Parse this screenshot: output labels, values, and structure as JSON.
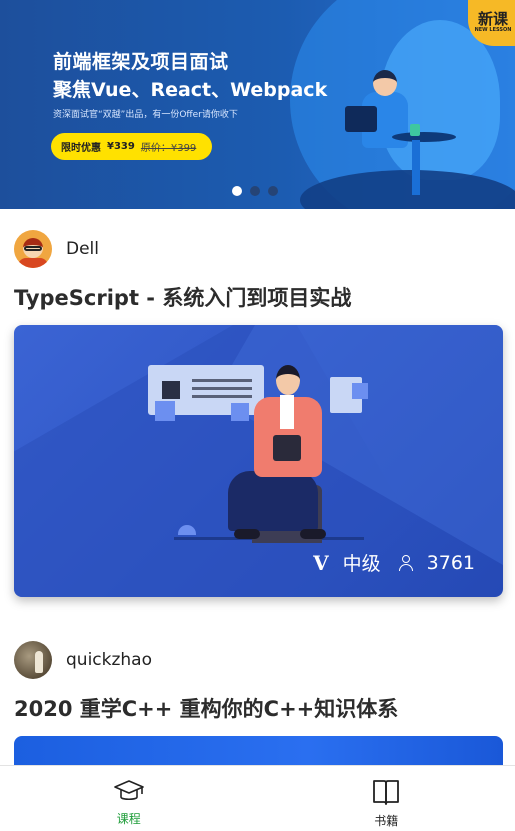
{
  "banner": {
    "headline_line1": "前端框架及项目面试",
    "headline_line2": "聚焦Vue、React、Webpack",
    "subline": "资深面试官“双越”出品，有一份Offer请你收下",
    "promo_tag": "限时优惠",
    "promo_price": "¥339",
    "promo_old_price": "原价：¥399",
    "badge_big": "新课",
    "badge_small": "NEW LESSON",
    "carousel": {
      "total": 3,
      "active": 1
    }
  },
  "courses": [
    {
      "author": "Dell",
      "title": "TypeScript  - 系统入门到项目实战",
      "level": "中级",
      "students": "3761"
    },
    {
      "author": "quickzhao",
      "title": "2020 重学C++ 重构你的C++知识体系"
    }
  ],
  "tabbar": {
    "items": [
      {
        "label": "课程",
        "icon": "graduation-cap-icon",
        "active": true
      },
      {
        "label": "书籍",
        "icon": "open-book-icon",
        "active": false
      }
    ],
    "active_color": "#1f9d3a"
  }
}
